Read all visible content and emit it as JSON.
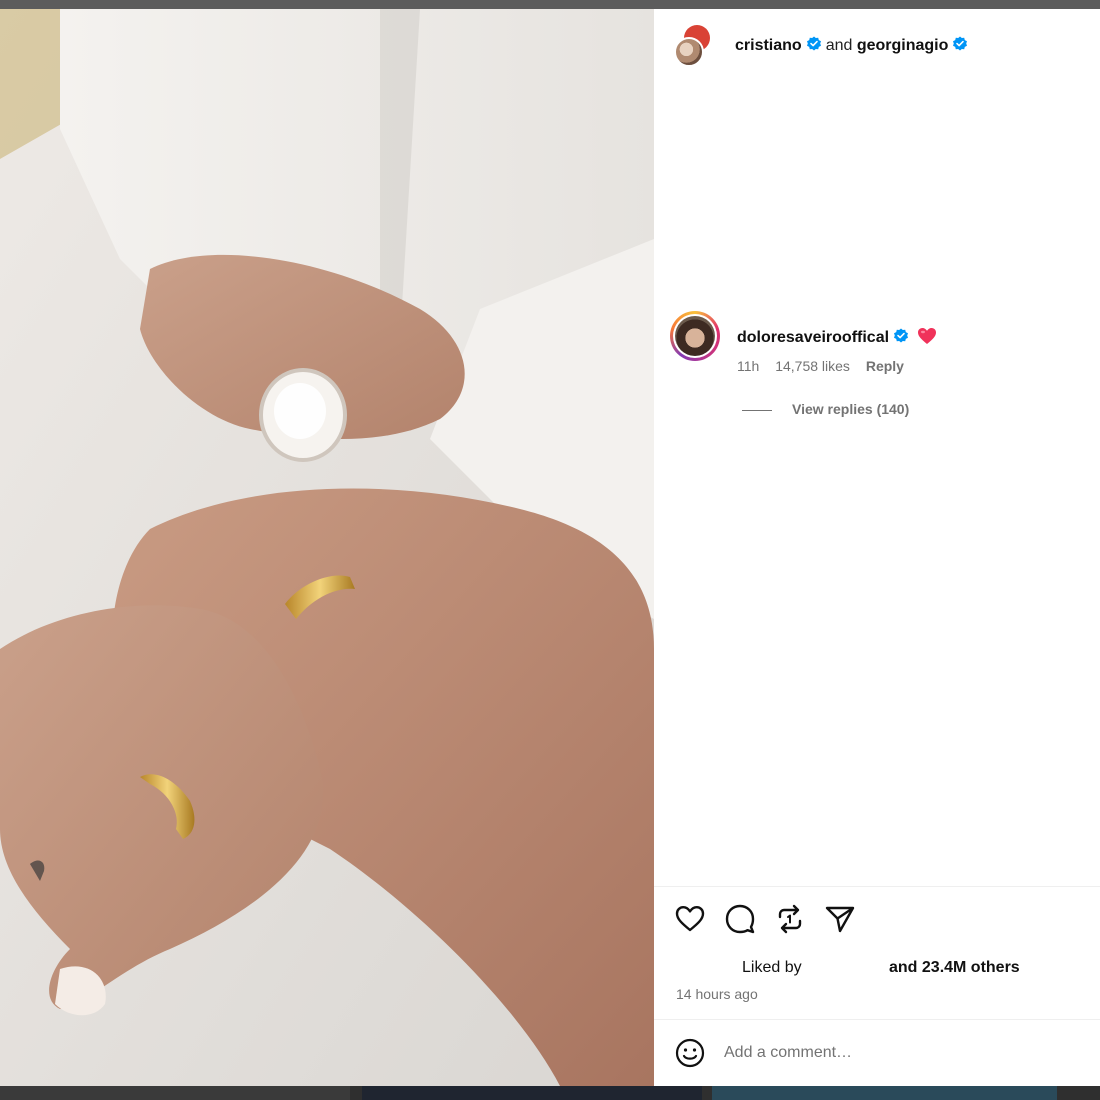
{
  "post": {
    "authors": [
      {
        "username": "cristiano",
        "verified": true
      },
      {
        "username": "georginagio",
        "verified": true
      }
    ],
    "connector": "and",
    "image_alt": "Two hands with gold wedding rings",
    "comment": {
      "username": "doloresaveirooffical",
      "verified": true,
      "emoji": "heart",
      "age": "11h",
      "likes": "14,758 likes",
      "reply_label": "Reply",
      "view_replies": "View replies (140)"
    },
    "liked_by_prefix": "Liked by",
    "liked_by_suffix": "and 23.4M others",
    "timestamp": "14 hours ago",
    "comment_placeholder": "Add a comment…"
  },
  "colors": {
    "verified": "#0095f6",
    "heart": "#f0325a",
    "muted_text": "#737373"
  },
  "icons": [
    "like-icon",
    "comment-icon",
    "repost-icon",
    "share-icon",
    "emoji-icon"
  ]
}
